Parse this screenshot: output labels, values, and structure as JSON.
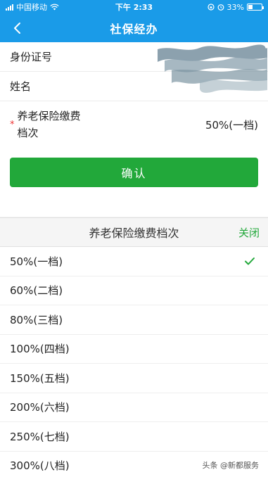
{
  "status_bar": {
    "carrier": "中国移动",
    "time": "下午 2:33",
    "battery": "33%",
    "battery_level": 0.33
  },
  "nav": {
    "title": "社保经办"
  },
  "form": {
    "id_label": "身份证号",
    "name_label": "姓名",
    "required_mark": "*",
    "level_label": "养老保险缴费档次",
    "level_value": "50%(一档)"
  },
  "confirm_label": "确认",
  "sheet": {
    "title": "养老保险缴费档次",
    "close_label": "关闭",
    "options": [
      {
        "label": "50%(一档)",
        "selected": true
      },
      {
        "label": "60%(二档)",
        "selected": false
      },
      {
        "label": "80%(三档)",
        "selected": false
      },
      {
        "label": "100%(四档)",
        "selected": false
      },
      {
        "label": "150%(五档)",
        "selected": false
      },
      {
        "label": "200%(六档)",
        "selected": false
      },
      {
        "label": "250%(七档)",
        "selected": false
      },
      {
        "label": "300%(八档)",
        "selected": false
      }
    ]
  },
  "watermark": "头条 @新都服务",
  "colors": {
    "header_blue": "#1a9be8",
    "accent_green": "#22a83a",
    "required_red": "#e33333"
  }
}
